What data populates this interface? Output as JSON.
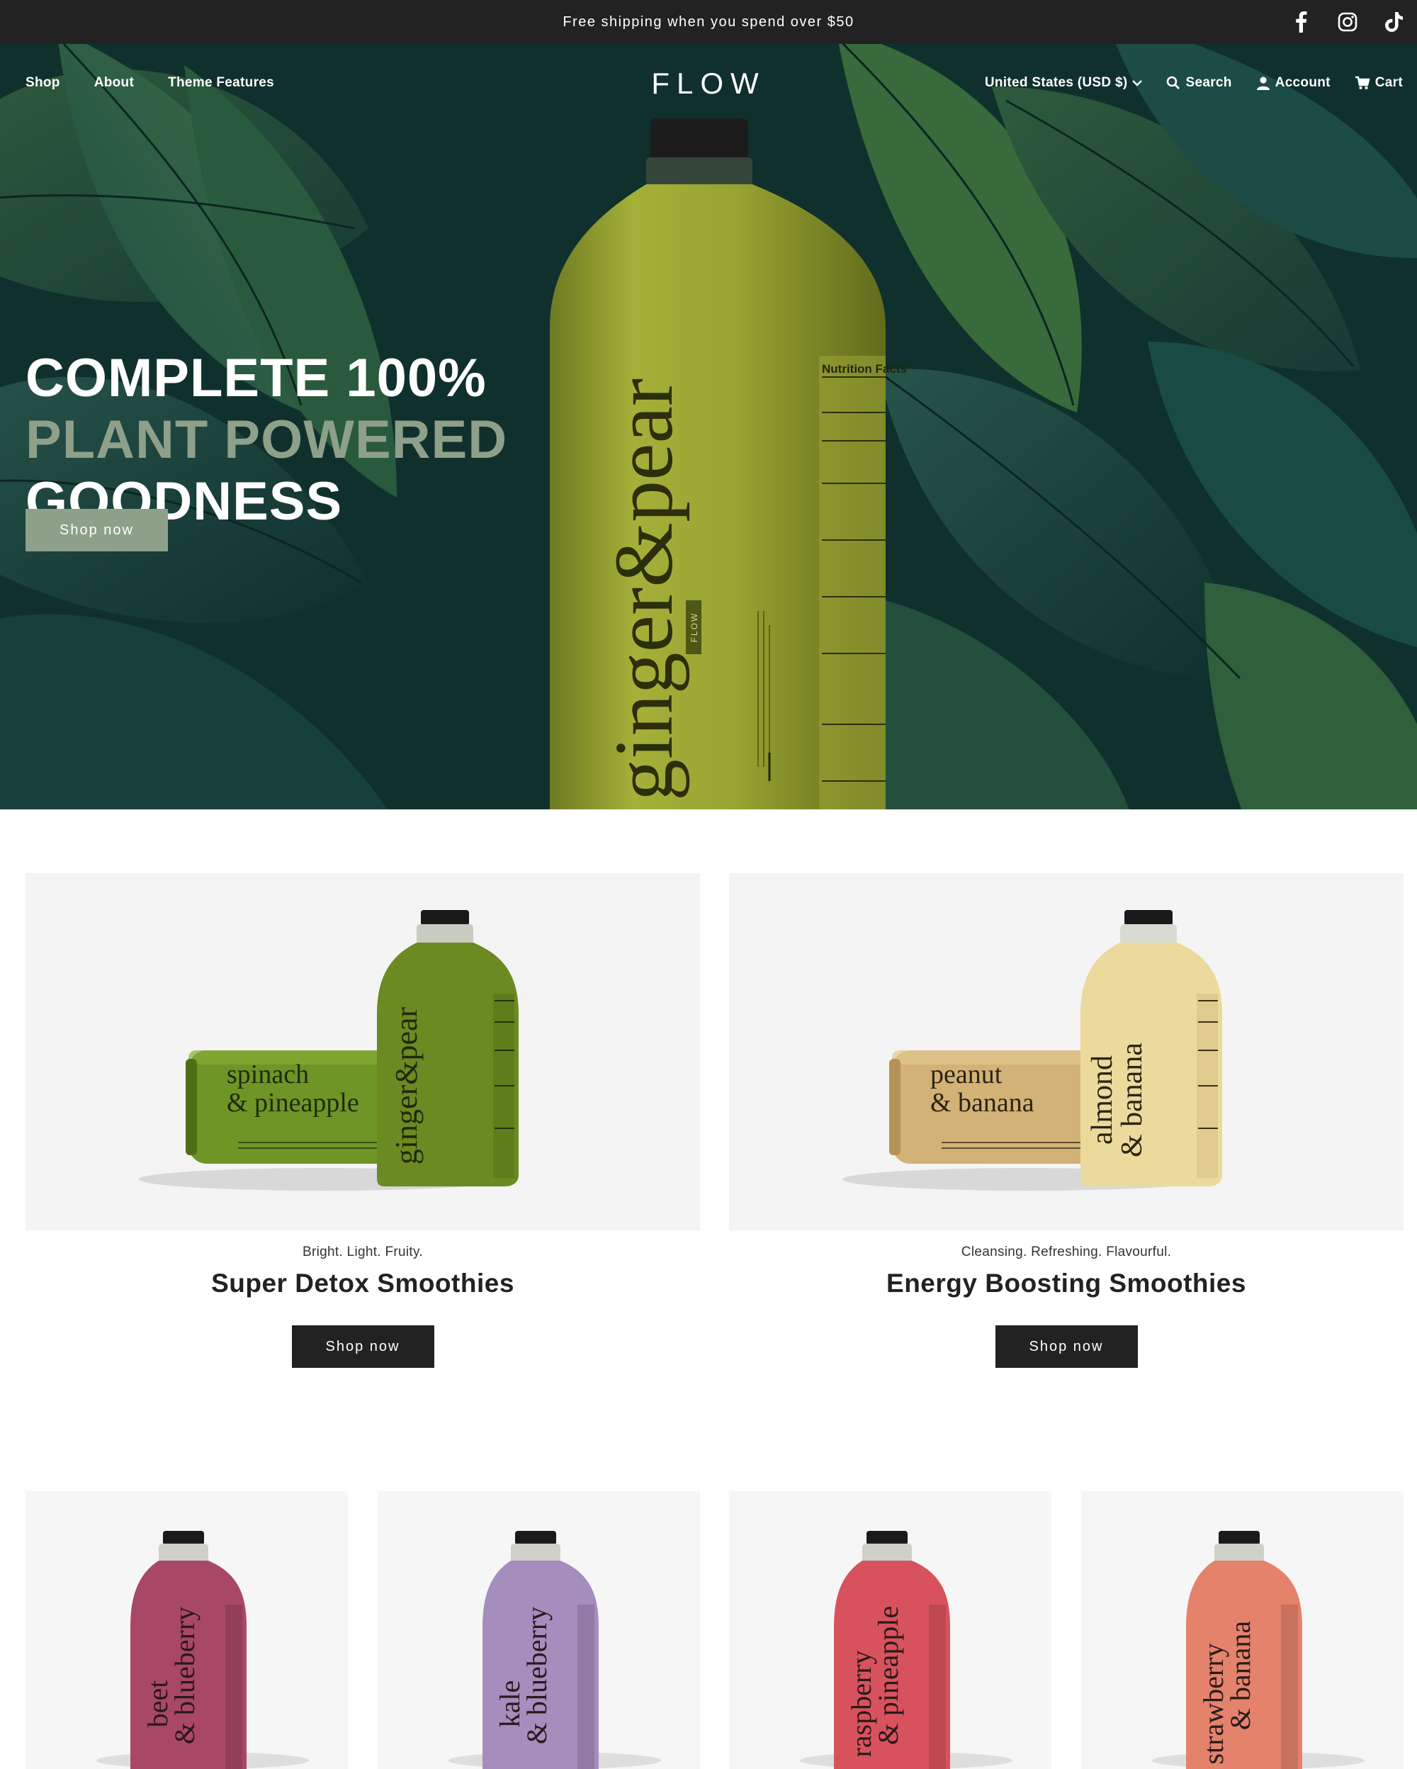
{
  "announcement": {
    "text": "Free shipping when you spend over $50"
  },
  "social": [
    "facebook-icon",
    "instagram-icon",
    "tiktok-icon"
  ],
  "header": {
    "logo": "FLOW",
    "nav_left": [
      "Shop",
      "About",
      "Theme Features"
    ],
    "currency": "United States (USD $)",
    "search": "Search",
    "account": "Account",
    "cart": "Cart"
  },
  "hero": {
    "title_line1": "COMPLETE 100%",
    "title_line2": "PLANT POWERED",
    "title_line3": "GOODNESS",
    "button": "Shop now",
    "bottle_label": "ginger&pear",
    "bottle_brand": "FLOW",
    "nutrition_heading": "Nutrition Facts"
  },
  "collections": [
    {
      "tagline": "Bright. Light. Fruity.",
      "title": "Super Detox Smoothies",
      "button": "Shop now",
      "bottle_lying": [
        "spinach",
        "& pineapple"
      ],
      "bottle_standing": "ginger&pear"
    },
    {
      "tagline": "Cleansing. Refreshing. Flavourful.",
      "title": "Energy Boosting Smoothies",
      "button": "Shop now",
      "bottle_lying": [
        "peanut",
        "& banana"
      ],
      "bottle_standing": [
        "almond",
        "& banana"
      ]
    }
  ],
  "products": [
    {
      "label": [
        "beet",
        "& blueberry"
      ],
      "color": "#a94866"
    },
    {
      "label": [
        "kale",
        "& blueberry"
      ],
      "color": "#a58dbd"
    },
    {
      "label": [
        "raspberry",
        "& pineapple"
      ],
      "color": "#d8525d"
    },
    {
      "label": [
        "strawberry",
        "& banana"
      ],
      "color": "#e4826c"
    }
  ],
  "colors": {
    "accent": "#8ea08a",
    "dark": "#222222",
    "hero_bg": "#0f2e2b"
  }
}
